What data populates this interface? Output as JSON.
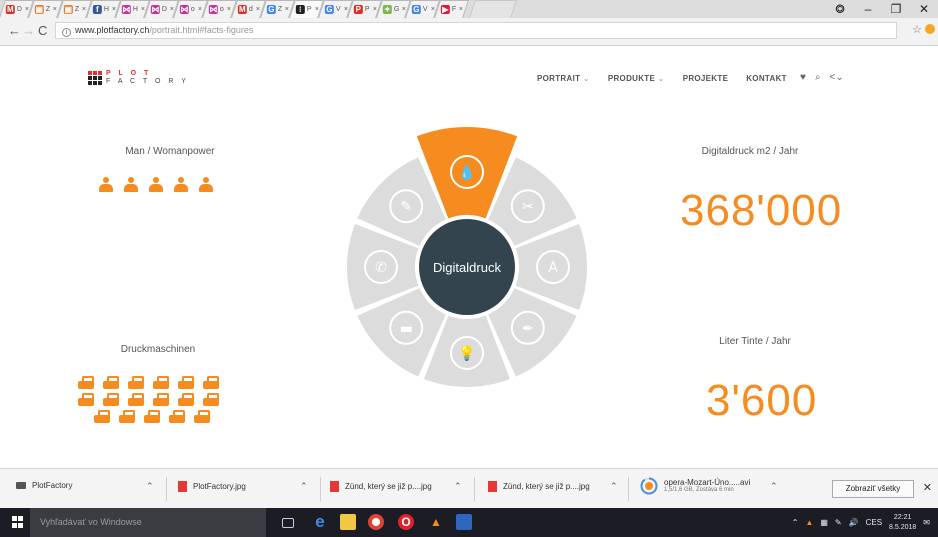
{
  "browser": {
    "tabs": [
      {
        "label": "D",
        "favicon": "gmail-icon",
        "color": "#d93025",
        "glyph": "M"
      },
      {
        "label": "Z",
        "favicon": "orange-grid-icon",
        "color": "#e5782a",
        "glyph": "▣"
      },
      {
        "label": "Z",
        "favicon": "orange-grid-icon",
        "color": "#e5782a",
        "glyph": "▣"
      },
      {
        "label": "H",
        "favicon": "facebook-icon",
        "color": "#3b5998",
        "glyph": "f"
      },
      {
        "label": "H",
        "favicon": "bow-icon",
        "color": "#c2359a",
        "glyph": "⋈"
      },
      {
        "label": "D",
        "favicon": "bow-icon",
        "color": "#c2359a",
        "glyph": "⋈"
      },
      {
        "label": "o",
        "favicon": "bow-icon",
        "color": "#c2359a",
        "glyph": "⋈"
      },
      {
        "label": "o",
        "favicon": "bow-icon",
        "color": "#c2359a",
        "glyph": "⋈"
      },
      {
        "label": "d",
        "favicon": "gmail-icon",
        "color": "#d93025",
        "glyph": "M"
      },
      {
        "label": "Z",
        "favicon": "google-icon",
        "color": "#4285f4",
        "glyph": "G"
      },
      {
        "label": "P",
        "favicon": "plotfactory-icon",
        "color": "#222222",
        "glyph": "⁝",
        "active": true
      },
      {
        "label": "V",
        "favicon": "google-icon",
        "color": "#4285f4",
        "glyph": "G"
      },
      {
        "label": "P",
        "favicon": "pinterest-icon",
        "color": "#e02b27",
        "glyph": "P"
      },
      {
        "label": "G",
        "favicon": "leaf-icon",
        "color": "#7ab648",
        "glyph": "✦"
      },
      {
        "label": "V",
        "favicon": "google-icon",
        "color": "#4285f4",
        "glyph": "G"
      },
      {
        "label": "F",
        "favicon": "red-play-icon",
        "color": "#e3173a",
        "glyph": "▶"
      }
    ],
    "url_host": "www.plotfactory.ch",
    "url_path": "/portrait.html#facts-figures"
  },
  "site": {
    "logo_text": "PLOT FACTORY",
    "logo_top": "P L O T",
    "logo_bottom": "F A C T O R Y",
    "nav": [
      "PORTRAIT",
      "PRODUKTE",
      "PROJEKTE",
      "KONTAKT"
    ],
    "facts": {
      "manpower_label": "Man / Womanpower",
      "manpower_count": 5,
      "printers_label": "Druckmaschinen",
      "printers_rows": [
        6,
        6,
        5
      ],
      "print_label": "Digitaldruck m2 / Jahr",
      "print_value": "368'000",
      "ink_label": "Liter Tinte / Jahr",
      "ink_value": "3'600"
    },
    "wheel": {
      "center_label": "Digitaldruck",
      "segments": [
        "drop-icon",
        "scissors-icon",
        "letter-a-icon",
        "pen-nib-icon",
        "lightbulb-icon",
        "image-icon",
        "phone-icon",
        "pen-icon"
      ],
      "active_segment": 0,
      "accent": "#f68b1f"
    }
  },
  "downloads": [
    {
      "name": "PlotFactory",
      "icon": "file-icon"
    },
    {
      "name": "PlotFactory.jpg",
      "icon": "image-file-icon"
    },
    {
      "name": "Zünd, který se již p....jpg",
      "icon": "image-file-icon"
    },
    {
      "name": "Zünd, který se již p....jpg",
      "icon": "image-file-icon"
    },
    {
      "name": "opera-Mozart-Úno.....avi",
      "sub": "1,5/1,6 GB, Zostáva 6 min",
      "icon": "progress-icon",
      "progress": 0.9
    }
  ],
  "downloads_show_all": "Zobraziť všetky",
  "taskbar": {
    "search_placeholder": "Vyhľadávať vo Windowse",
    "apps": [
      "task-view-icon",
      "edge-icon",
      "file-explorer-icon",
      "chrome-icon",
      "opera-icon",
      "vlc-icon",
      "document-icon"
    ],
    "lang": "CES",
    "time": "22:21",
    "date": "8.5.2018"
  }
}
